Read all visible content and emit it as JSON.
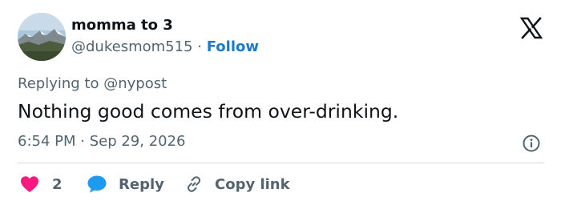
{
  "author": {
    "display_name": "momma to 3",
    "handle": "@dukesmom515",
    "separator": "·",
    "follow_label": "Follow"
  },
  "reply_context": {
    "prefix": "Replying to ",
    "mention": "@nypost"
  },
  "tweet": {
    "text": "Nothing good comes from over-drinking.",
    "timestamp": "6:54 PM · Sep 29, 2026"
  },
  "actions": {
    "like_count": "2",
    "reply_label": "Reply",
    "copy_label": "Copy link"
  },
  "colors": {
    "link_blue": "#1d79c9",
    "heart_red": "#f91880",
    "reply_blue": "#1d9bf0",
    "muted": "#536471",
    "text": "#0f1419"
  },
  "icons": {
    "logo": "x-logo-icon",
    "info": "info-icon",
    "like": "heart-icon",
    "reply": "speech-bubble-icon",
    "copy": "link-icon"
  }
}
